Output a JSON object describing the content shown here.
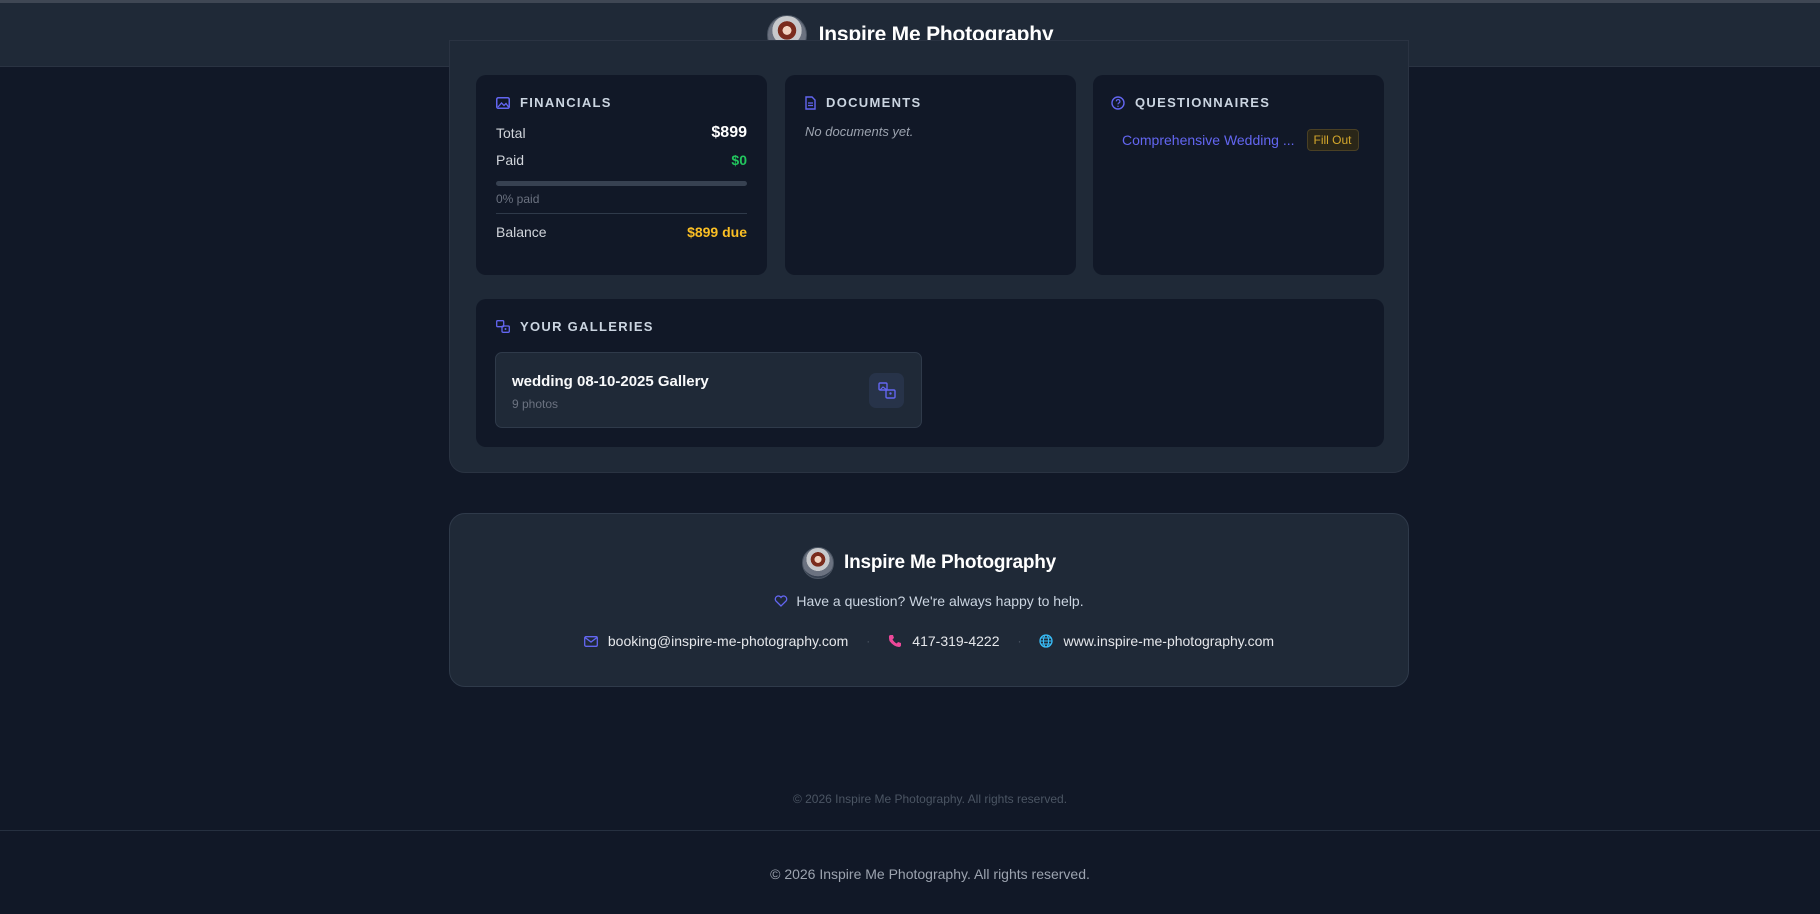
{
  "header": {
    "brand_name": "Inspire Me Photography",
    "avatar_icon": "studio-logo-avatar"
  },
  "financials": {
    "title": "Financials",
    "icon": "image-icon",
    "total_label": "Total",
    "total_value": "$899",
    "paid_label": "Paid",
    "paid_value": "$0",
    "progress_fraction": 0,
    "progress_text": "0% paid",
    "balance_label": "Balance",
    "balance_value": "$899 due"
  },
  "documents": {
    "title": "Documents",
    "icon": "document-icon",
    "empty_text": "No documents yet."
  },
  "questionnaires": {
    "title": "Questionnaires",
    "icon": "question-circle-icon",
    "items": [
      {
        "label": "Comprehensive Wedding ...",
        "status": "Fill Out"
      }
    ]
  },
  "galleries": {
    "title": "Your Galleries",
    "icon": "gallery-icon",
    "items": [
      {
        "name": "wedding 08-10-2025 Gallery",
        "count": "9 photos"
      }
    ]
  },
  "footer": {
    "brand_name": "Inspire Me Photography",
    "tagline": "Have a question? We're always happy to help.",
    "email": "booking@inspire-me-photography.com",
    "phone": "417-319-4222",
    "website": "www.inspire-me-photography.com",
    "separator": "·"
  },
  "copyright_inner": "© 2026 Inspire Me Photography. All rights reserved.",
  "copyright_outer": "© 2026 Inspire Me Photography. All rights reserved.",
  "colors": {
    "accent": "#6366f1",
    "paid_green": "#22c55e",
    "due_amber": "#fbbf24",
    "phone_pink": "#ec4899",
    "globe_cyan": "#38bdf8"
  }
}
